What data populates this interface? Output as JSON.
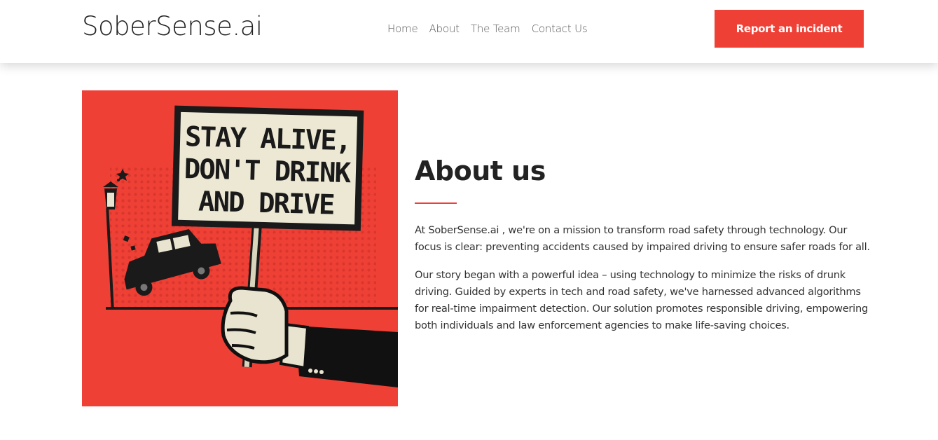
{
  "navbar": {
    "brand": "SoberSense.ai",
    "links": [
      {
        "label": "Home"
      },
      {
        "label": "About"
      },
      {
        "label": "The Team"
      },
      {
        "label": "Contact Us"
      }
    ],
    "cta_label": "Report an incident"
  },
  "hero": {
    "sign_lines": [
      "STAY ALIVE,",
      "DON'T DRINK",
      "AND DRIVE"
    ]
  },
  "about": {
    "title": "About us",
    "paragraphs": [
      "At SoberSense.ai , we're on a mission to transform road safety through technology. Our focus is clear: preventing accidents caused by impaired driving to ensure safer roads for all.",
      "Our story began with a powerful idea – using technology to minimize the risks of drunk driving. Guided by experts in tech and road safety, we've harnessed advanced algorithms for real-time impairment detection. Our solution promotes responsible driving, empowering both individuals and law enforcement agencies to make life-saving choices."
    ]
  },
  "colors": {
    "accent": "#ef4036",
    "text": "#212529",
    "sign_paper": "#ece8d4"
  }
}
